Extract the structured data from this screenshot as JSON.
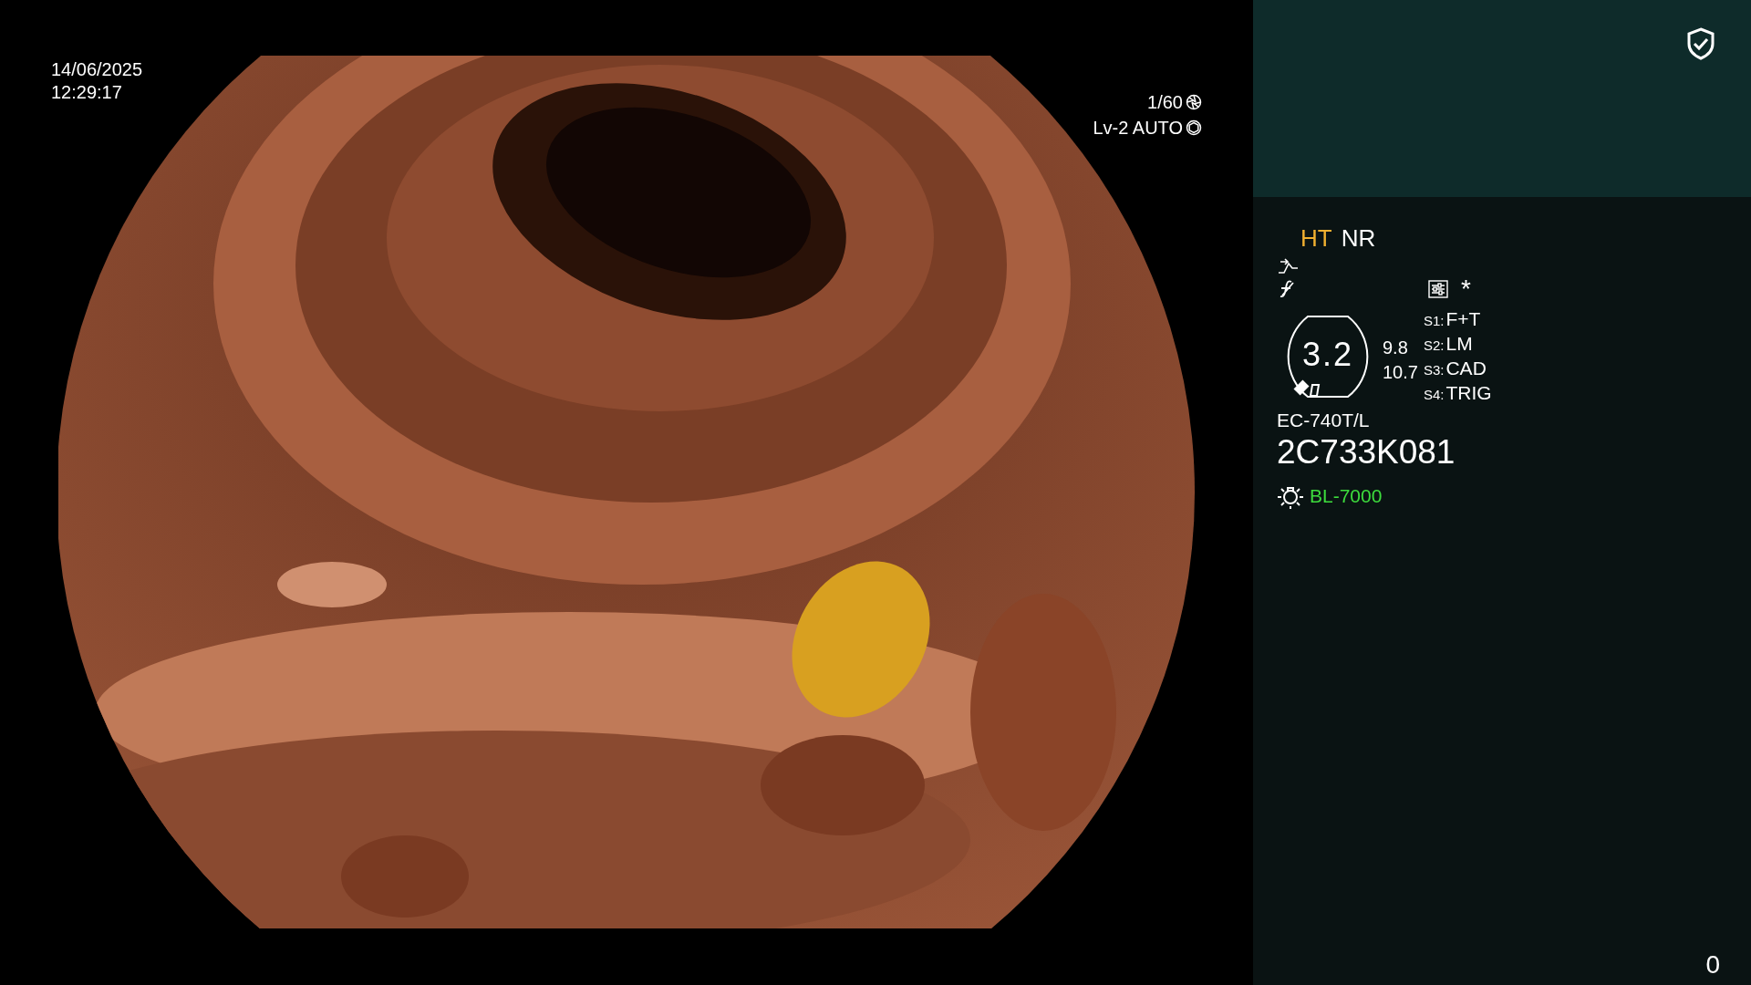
{
  "datetime": {
    "date": "14/06/2025",
    "time": "12:29:17"
  },
  "exposure": {
    "shutter": "1/60",
    "iris": "Lv-2 AUTO"
  },
  "panel": {
    "modes": [
      {
        "label": "HT",
        "color": "#f0b030"
      },
      {
        "label": "NR",
        "color": "#ffffff"
      }
    ],
    "marker": "*",
    "zoom": "3.2",
    "readings": [
      "9.8",
      "10.7"
    ],
    "switches": [
      {
        "key": "S1:",
        "value": "F+T"
      },
      {
        "key": "S2:",
        "value": "LM"
      },
      {
        "key": "S3:",
        "value": "CAD"
      },
      {
        "key": "S4:",
        "value": "TRIG"
      }
    ],
    "scope_model": "EC-740T/L",
    "serial": "2C733K081",
    "light_source": "BL-7000",
    "counter": "0"
  }
}
